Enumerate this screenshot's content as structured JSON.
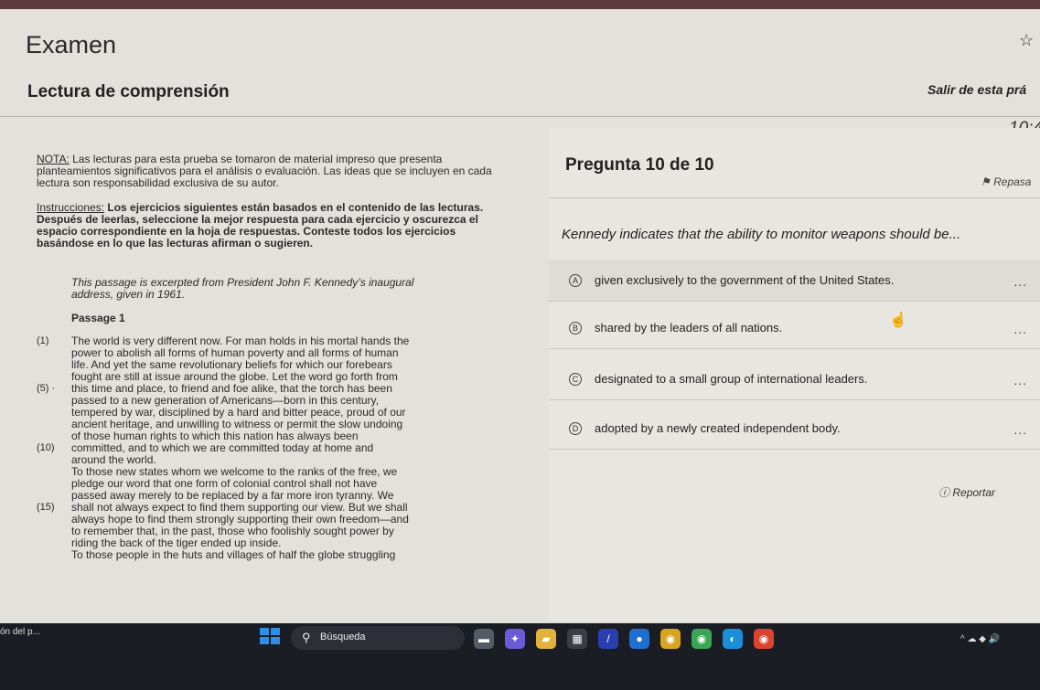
{
  "header": {
    "title": "Examen",
    "subtitle": "Lectura de comprensión",
    "exit_label": "Salir de esta prá",
    "timer": "10:4"
  },
  "left": {
    "note_label": "NOTA:",
    "note_text": "Las lecturas para esta prueba se tomaron de material impreso que presenta planteamientos significativos para el análisis o evaluación. Las ideas que se incluyen en cada lectura son responsabilidad exclusiva de su autor.",
    "instructions_label": "Instrucciones:",
    "instructions_text": "Los ejercicios siguientes están basados en el contenido de las lecturas. Después de leerlas, seleccione la mejor respuesta para cada ejercicio y oscurezca el espacio correspondiente en la hoja de respuestas. Conteste todos los ejercicios basándose en lo que las lecturas afirman o sugieren.",
    "intro": "This passage is excerpted from President John F. Kennedy’s inaugural address, given in 1961.",
    "passage_title": "Passage 1",
    "lines": [
      {
        "num": "(1)",
        "text": "The world is very different now. For man holds in his mortal hands the"
      },
      {
        "num": "",
        "text": "power to abolish all forms of human poverty and all forms of human"
      },
      {
        "num": "",
        "text": "life. And yet the same revolutionary beliefs for which our forebears"
      },
      {
        "num": "",
        "text": "fought are still at issue around the globe. Let the word go forth from"
      },
      {
        "num": "(5) ·",
        "text": "this time and place, to friend and foe alike, that the torch has been"
      },
      {
        "num": "",
        "text": "passed to a new generation of Americans—born in this century,"
      },
      {
        "num": "",
        "text": "tempered by war, disciplined by a hard and bitter peace, proud of our"
      },
      {
        "num": "",
        "text": "ancient heritage, and unwilling to witness or permit the slow undoing"
      },
      {
        "num": "",
        "text": "of those human rights to which this nation has always been"
      },
      {
        "num": "(10)",
        "text": "committed, and to which we are committed today at home and"
      },
      {
        "num": "",
        "text": "around the world."
      },
      {
        "num": "",
        "text": "      To those new states whom we welcome to the ranks of the free, we"
      },
      {
        "num": "",
        "text": "pledge our word that one form of colonial control shall not have"
      },
      {
        "num": "",
        "text": "passed away merely to be replaced by a far more iron tyranny. We"
      },
      {
        "num": "(15)",
        "text": "shall not always expect to find them supporting our view. But we shall"
      },
      {
        "num": "",
        "text": "always hope to find them strongly supporting their own freedom—and"
      },
      {
        "num": "",
        "text": "to remember that, in the past, those who foolishly sought power by"
      },
      {
        "num": "",
        "text": "riding the back of the tiger ended up inside."
      },
      {
        "num": "",
        "text": "      To those people in the huts and villages of half the globe struggling"
      }
    ]
  },
  "question": {
    "title": "Pregunta 10 de 10",
    "review_label": "Repasa",
    "text": "Kennedy indicates that the ability to monitor weapons should be...",
    "report_label": "Reportar",
    "options": [
      {
        "letter": "A",
        "text": "given exclusively to the government of the United States.",
        "more": "..."
      },
      {
        "letter": "B",
        "text": "shared by the leaders of all nations.",
        "more": "..."
      },
      {
        "letter": "C",
        "text": "designated to a small group of international leaders.",
        "more": "..."
      },
      {
        "letter": "D",
        "text": "adopted by a newly created independent body.",
        "more": "..."
      }
    ]
  },
  "taskbar": {
    "left_text": "ón del p...",
    "search_label": "Búsqueda",
    "apps": [
      "file-explorer",
      "copilot",
      "folder",
      "calendar",
      "ai-app",
      "outlook",
      "chrome-canary",
      "chrome",
      "edge",
      "chrome-alt"
    ],
    "tray_text": "^  ☁  ◆  🔊"
  },
  "colors": {
    "page_bg": "#e3e1dc",
    "top_band": "#5a3a3f",
    "taskbar": "#1b1d24",
    "windows_blue": "#2f8ee8"
  }
}
